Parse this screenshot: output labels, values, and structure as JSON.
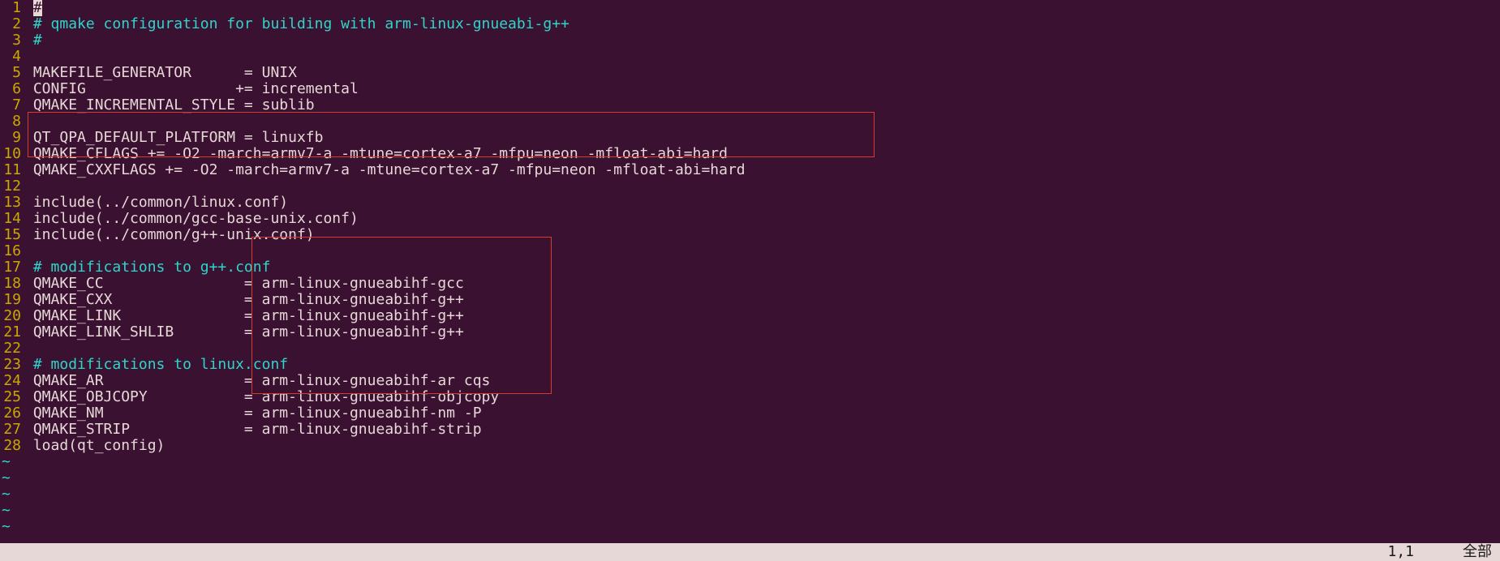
{
  "lines": [
    {
      "n": 1,
      "segs": [
        {
          "t": "#",
          "cls": "cursor"
        }
      ]
    },
    {
      "n": 2,
      "segs": [
        {
          "t": "# qmake configuration for building with arm-linux-gnueabi-g++",
          "cls": "comment"
        }
      ]
    },
    {
      "n": 3,
      "segs": [
        {
          "t": "#",
          "cls": "comment"
        }
      ]
    },
    {
      "n": 4,
      "segs": []
    },
    {
      "n": 5,
      "segs": [
        {
          "t": "MAKEFILE_GENERATOR      = UNIX",
          "cls": ""
        }
      ]
    },
    {
      "n": 6,
      "segs": [
        {
          "t": "CONFIG                 += incremental",
          "cls": ""
        }
      ]
    },
    {
      "n": 7,
      "segs": [
        {
          "t": "QMAKE_INCREMENTAL_STYLE = sublib",
          "cls": ""
        }
      ]
    },
    {
      "n": 8,
      "segs": []
    },
    {
      "n": 9,
      "segs": [
        {
          "t": "QT_QPA_DEFAULT_PLATFORM = linuxfb",
          "cls": ""
        }
      ]
    },
    {
      "n": 10,
      "segs": [
        {
          "t": "QMAKE_CFLAGS += -O2 -march=armv7-a -mtune=cortex-a7 -mfpu=neon -mfloat-abi=hard",
          "cls": ""
        }
      ]
    },
    {
      "n": 11,
      "segs": [
        {
          "t": "QMAKE_CXXFLAGS += -O2 -march=armv7-a -mtune=cortex-a7 -mfpu=neon -mfloat-abi=hard",
          "cls": ""
        }
      ]
    },
    {
      "n": 12,
      "segs": []
    },
    {
      "n": 13,
      "segs": [
        {
          "t": "include(../common/linux.conf)",
          "cls": ""
        }
      ]
    },
    {
      "n": 14,
      "segs": [
        {
          "t": "include(../common/gcc-base-unix.conf)",
          "cls": ""
        }
      ]
    },
    {
      "n": 15,
      "segs": [
        {
          "t": "include(../common/g++-unix.conf)",
          "cls": ""
        }
      ]
    },
    {
      "n": 16,
      "segs": []
    },
    {
      "n": 17,
      "segs": [
        {
          "t": "# modifications to g++.conf",
          "cls": "comment"
        }
      ]
    },
    {
      "n": 18,
      "segs": [
        {
          "t": "QMAKE_CC                = arm-linux-gnueabihf-gcc",
          "cls": ""
        }
      ]
    },
    {
      "n": 19,
      "segs": [
        {
          "t": "QMAKE_CXX               = arm-linux-gnueabihf-g++",
          "cls": ""
        }
      ]
    },
    {
      "n": 20,
      "segs": [
        {
          "t": "QMAKE_LINK              = arm-linux-gnueabihf-g++",
          "cls": ""
        }
      ]
    },
    {
      "n": 21,
      "segs": [
        {
          "t": "QMAKE_LINK_SHLIB        = arm-linux-gnueabihf-g++",
          "cls": ""
        }
      ]
    },
    {
      "n": 22,
      "segs": []
    },
    {
      "n": 23,
      "segs": [
        {
          "t": "# modifications to linux.conf",
          "cls": "comment"
        }
      ]
    },
    {
      "n": 24,
      "segs": [
        {
          "t": "QMAKE_AR                = arm-linux-gnueabihf-ar cqs",
          "cls": ""
        }
      ]
    },
    {
      "n": 25,
      "segs": [
        {
          "t": "QMAKE_OBJCOPY           = arm-linux-gnueabihf-objcopy",
          "cls": ""
        }
      ]
    },
    {
      "n": 26,
      "segs": [
        {
          "t": "QMAKE_NM                = arm-linux-gnueabihf-nm -P",
          "cls": ""
        }
      ]
    },
    {
      "n": 27,
      "segs": [
        {
          "t": "QMAKE_STRIP             = arm-linux-gnueabihf-strip",
          "cls": ""
        }
      ]
    },
    {
      "n": 28,
      "segs": [
        {
          "t": "load(qt_config)",
          "cls": ""
        }
      ]
    }
  ],
  "tildes": 5,
  "status": {
    "pos": "1,1",
    "mode": "全部"
  },
  "colors": {
    "bg": "#3b1132",
    "fg": "#e6d8d6",
    "comment": "#2dd6c9",
    "gutter": "#c9a800",
    "box": "#d43c2c",
    "statusbg": "#e6d8d6"
  }
}
